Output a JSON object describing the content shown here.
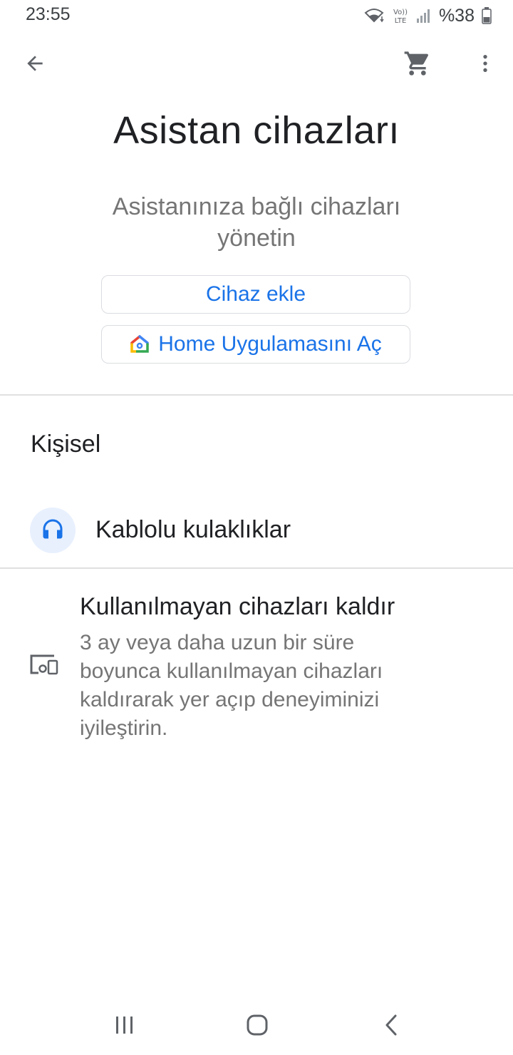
{
  "status_bar": {
    "time": "23:55",
    "battery_text": "%38",
    "icons": [
      "wifi-icon",
      "volte-lte-icon",
      "signal-icon",
      "battery-icon"
    ]
  },
  "app_bar": {
    "icons": [
      "arrow-back-icon",
      "shopping-cart-icon",
      "more-vert-icon"
    ]
  },
  "header": {
    "title": "Asistan cihazları",
    "subtitle": "Asistanınıza bağlı cihazları yönetin"
  },
  "buttons": {
    "add_device": "Cihaz ekle",
    "open_home": "Home Uygulamasını Aç"
  },
  "section": {
    "title": "Kişisel"
  },
  "devices": [
    {
      "label": "Kablolu kulaklıklar",
      "icon": "headphones-icon"
    }
  ],
  "remove_unused": {
    "title": "Kullanılmayan cihazları kaldır",
    "description": "3 ay veya daha uzun bir süre boyunca kullanılmayan cihazları kaldırarak yer açıp deneyiminizi iyileştirin.",
    "icon": "devices-icon"
  },
  "nav_bar": {
    "icons": [
      "recent-apps-icon",
      "home-icon",
      "back-icon"
    ]
  },
  "colors": {
    "accent": "#1a73e8",
    "text_primary": "#202124",
    "text_secondary": "#757575",
    "divider": "#e0e0e0",
    "avatar_bg": "#e8f0fe"
  }
}
